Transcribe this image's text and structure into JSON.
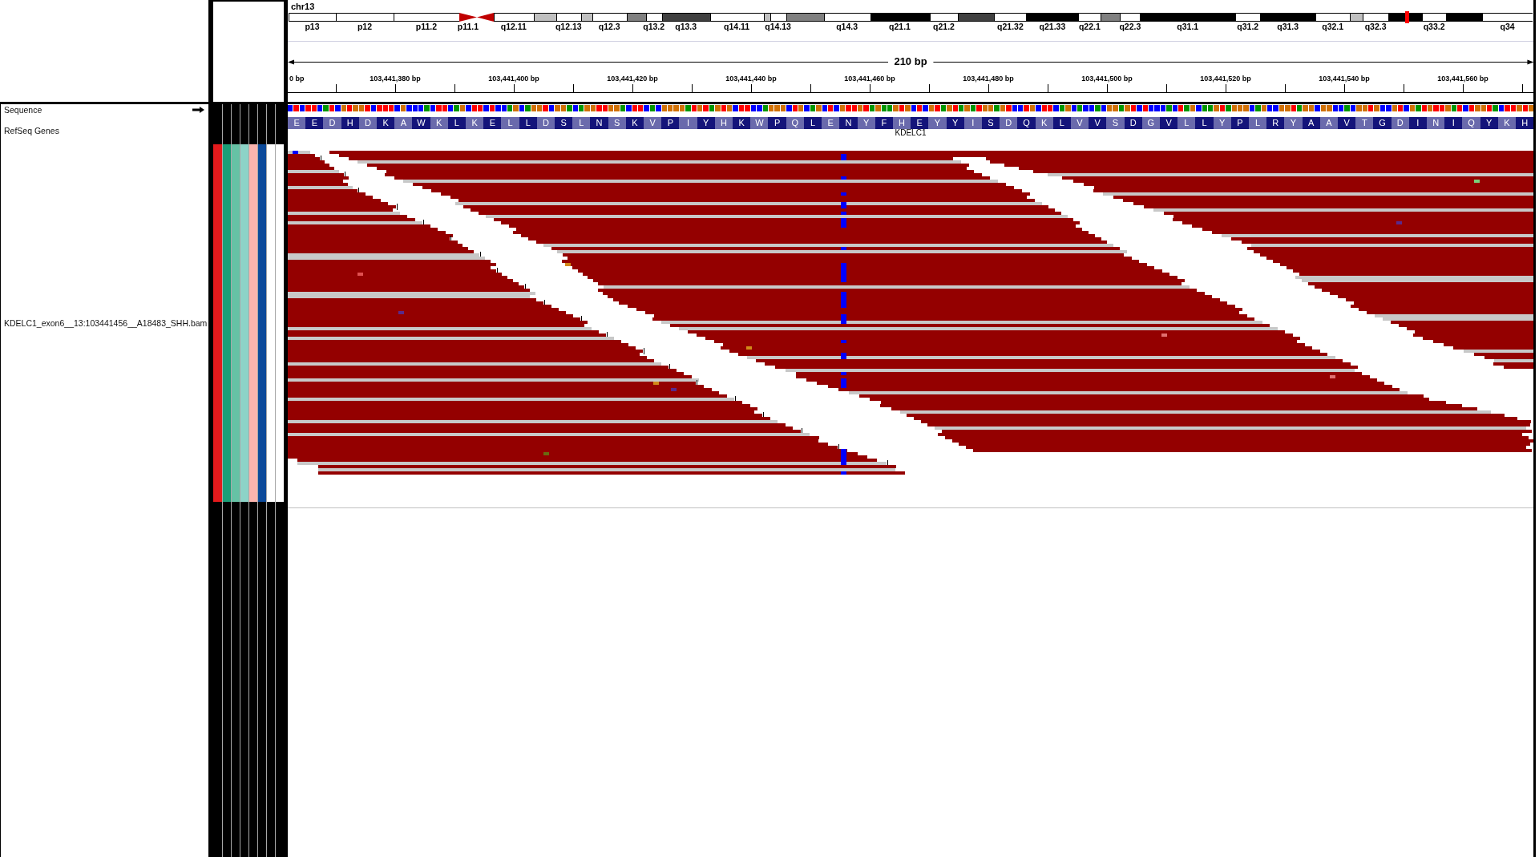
{
  "ideogram": {
    "chromosome": "chr13",
    "bands": [
      {
        "kind": "band",
        "color": "#ffffff",
        "label": "p13"
      },
      {
        "kind": "band",
        "color": "#ffffff",
        "label": "p12"
      },
      {
        "kind": "band",
        "color": "#ffffff",
        "label": "p11.2"
      },
      {
        "kind": "centromere",
        "color": "#c00000",
        "label": "p11.1"
      },
      {
        "kind": "centromere",
        "color": "#c00000"
      },
      {
        "kind": "band",
        "color": "#ffffff",
        "label": "q12.11"
      },
      {
        "kind": "band",
        "color": "#c0c0c0"
      },
      {
        "kind": "band",
        "color": "#ffffff",
        "label": "q12.13"
      },
      {
        "kind": "band",
        "color": "#c0c0c0"
      },
      {
        "kind": "band",
        "color": "#ffffff",
        "label": "q12.3"
      },
      {
        "kind": "band",
        "color": "#808080"
      },
      {
        "kind": "band",
        "color": "#ffffff",
        "label": "q13.2"
      },
      {
        "kind": "band",
        "color": "#404040",
        "label": "q13.3"
      },
      {
        "kind": "band",
        "color": "#ffffff",
        "label": "q14.11"
      },
      {
        "kind": "band",
        "color": "#c0c0c0"
      },
      {
        "kind": "band",
        "color": "#ffffff",
        "label": "q14.13"
      },
      {
        "kind": "band",
        "color": "#808080"
      },
      {
        "kind": "band",
        "color": "#ffffff",
        "label": "q14.3"
      },
      {
        "kind": "band",
        "color": "#000000",
        "label": "q21.1"
      },
      {
        "kind": "band",
        "color": "#ffffff",
        "label": "q21.2"
      },
      {
        "kind": "band",
        "color": "#404040"
      },
      {
        "kind": "band",
        "color": "#ffffff",
        "label": "q21.32"
      },
      {
        "kind": "band",
        "color": "#000000",
        "label": "q21.33"
      },
      {
        "kind": "band",
        "color": "#ffffff",
        "label": "q22.1"
      },
      {
        "kind": "band",
        "color": "#808080"
      },
      {
        "kind": "band",
        "color": "#ffffff",
        "label": "q22.3"
      },
      {
        "kind": "band",
        "color": "#000000",
        "label": "q31.1"
      },
      {
        "kind": "band",
        "color": "#ffffff",
        "label": "q31.2"
      },
      {
        "kind": "band",
        "color": "#000000",
        "label": "q31.3"
      },
      {
        "kind": "band",
        "color": "#ffffff",
        "label": "q32.1"
      },
      {
        "kind": "band",
        "color": "#c0c0c0"
      },
      {
        "kind": "band",
        "color": "#ffffff",
        "label": "q32.3"
      },
      {
        "kind": "band",
        "color": "#000000"
      },
      {
        "kind": "band",
        "color": "#ffffff",
        "label": "q33.2"
      },
      {
        "kind": "band",
        "color": "#000000"
      },
      {
        "kind": "band",
        "color": "#ffffff",
        "label": "q34"
      }
    ]
  },
  "ruler": {
    "span": "210 bp",
    "tick_labels": [
      "0 bp",
      "103,441,380 bp",
      "103,441,400 bp",
      "103,441,420 bp",
      "103,441,440 bp",
      "103,441,460 bp",
      "103,441,480 bp",
      "103,441,500 bp",
      "103,441,520 bp",
      "103,441,540 bp",
      "103,441,560 bp"
    ]
  },
  "tracks": [
    {
      "kind": "sequence",
      "name": "Sequence",
      "forward_strand": true,
      "bases": [
        {
          "color": "#0000ff"
        },
        {
          "color": "#ff0000"
        },
        {
          "color": "#0000ff"
        },
        {
          "color": "#ff0000"
        },
        {
          "color": "#ff0000"
        },
        {
          "color": "#0000ff"
        },
        {
          "color": "#009600"
        },
        {
          "color": "#ff0000"
        },
        {
          "color": "#0000ff"
        },
        {
          "color": "#d17105"
        },
        {
          "color": "#ff0000"
        },
        {
          "color": "#d17105"
        },
        {
          "color": "#d17105"
        },
        {
          "color": "#ff0000"
        },
        {
          "color": "#0000ff"
        },
        {
          "color": "#ff0000"
        },
        {
          "color": "#ff0000"
        },
        {
          "color": "#ff0000"
        },
        {
          "color": "#0000ff"
        },
        {
          "color": "#d17105"
        },
        {
          "color": "#0000ff"
        },
        {
          "color": "#0000ff"
        },
        {
          "color": "#0000ff"
        },
        {
          "color": "#009600"
        },
        {
          "color": "#0000ff"
        },
        {
          "color": "#ff0000"
        },
        {
          "color": "#ff0000"
        },
        {
          "color": "#0000ff"
        },
        {
          "color": "#009600"
        },
        {
          "color": "#d17105"
        },
        {
          "color": "#0000ff"
        },
        {
          "color": "#ff0000"
        },
        {
          "color": "#ff0000"
        },
        {
          "color": "#0000ff"
        },
        {
          "color": "#ff0000"
        },
        {
          "color": "#0000ff"
        },
        {
          "color": "#0000ff"
        },
        {
          "color": "#009600"
        },
        {
          "color": "#d17105"
        },
        {
          "color": "#0000ff"
        },
        {
          "color": "#009600"
        },
        {
          "color": "#d17105"
        },
        {
          "color": "#d17105"
        },
        {
          "color": "#ff0000"
        },
        {
          "color": "#0000ff"
        },
        {
          "color": "#d17105"
        },
        {
          "color": "#d17105"
        },
        {
          "color": "#009600"
        },
        {
          "color": "#0000ff"
        },
        {
          "color": "#009600"
        },
        {
          "color": "#d17105"
        },
        {
          "color": "#d17105"
        },
        {
          "color": "#ff0000"
        },
        {
          "color": "#ff0000"
        },
        {
          "color": "#d17105"
        },
        {
          "color": "#d17105"
        },
        {
          "color": "#009600"
        },
        {
          "color": "#0000ff"
        },
        {
          "color": "#ff0000"
        },
        {
          "color": "#ff0000"
        },
        {
          "color": "#0000ff"
        },
        {
          "color": "#009600"
        },
        {
          "color": "#0000ff"
        },
        {
          "color": "#d17105"
        },
        {
          "color": "#d17105"
        },
        {
          "color": "#d17105"
        },
        {
          "color": "#d17105"
        },
        {
          "color": "#009600"
        },
        {
          "color": "#ff0000"
        },
        {
          "color": "#d17105"
        },
        {
          "color": "#ff0000"
        },
        {
          "color": "#009600"
        },
        {
          "color": "#d17105"
        },
        {
          "color": "#ff0000"
        },
        {
          "color": "#d17105"
        },
        {
          "color": "#0000ff"
        },
        {
          "color": "#ff0000"
        },
        {
          "color": "#ff0000"
        },
        {
          "color": "#0000ff"
        },
        {
          "color": "#0000ff"
        },
        {
          "color": "#009600"
        },
        {
          "color": "#d17105"
        },
        {
          "color": "#d17105"
        },
        {
          "color": "#d17105"
        },
        {
          "color": "#0000ff"
        },
        {
          "color": "#ff0000"
        },
        {
          "color": "#d17105"
        },
        {
          "color": "#0000ff"
        },
        {
          "color": "#009600"
        },
        {
          "color": "#d17105"
        },
        {
          "color": "#0000ff"
        },
        {
          "color": "#ff0000"
        },
        {
          "color": "#0000ff"
        },
        {
          "color": "#d17105"
        },
        {
          "color": "#ff0000"
        },
        {
          "color": "#ff0000"
        },
        {
          "color": "#d17105"
        },
        {
          "color": "#ff0000"
        },
        {
          "color": "#009600"
        },
        {
          "color": "#d17105"
        },
        {
          "color": "#009600"
        },
        {
          "color": "#009600"
        },
        {
          "color": "#d17105"
        },
        {
          "color": "#ff0000"
        },
        {
          "color": "#d17105"
        },
        {
          "color": "#0000ff"
        },
        {
          "color": "#ff0000"
        },
        {
          "color": "#0000ff"
        },
        {
          "color": "#d17105"
        },
        {
          "color": "#ff0000"
        },
        {
          "color": "#009600"
        },
        {
          "color": "#d17105"
        },
        {
          "color": "#ff0000"
        },
        {
          "color": "#009600"
        },
        {
          "color": "#d17105"
        },
        {
          "color": "#009600"
        },
        {
          "color": "#ff0000"
        },
        {
          "color": "#d17105"
        },
        {
          "color": "#d17105"
        },
        {
          "color": "#009600"
        },
        {
          "color": "#d17105"
        },
        {
          "color": "#ff0000"
        },
        {
          "color": "#0000ff"
        },
        {
          "color": "#0000ff"
        },
        {
          "color": "#ff0000"
        },
        {
          "color": "#d17105"
        },
        {
          "color": "#0000ff"
        },
        {
          "color": "#ff0000"
        },
        {
          "color": "#ff0000"
        },
        {
          "color": "#0000ff"
        },
        {
          "color": "#009600"
        },
        {
          "color": "#d17105"
        },
        {
          "color": "#0000ff"
        },
        {
          "color": "#009600"
        },
        {
          "color": "#0000ff"
        },
        {
          "color": "#0000ff"
        },
        {
          "color": "#009600"
        },
        {
          "color": "#0000ff"
        },
        {
          "color": "#d17105"
        },
        {
          "color": "#d17105"
        },
        {
          "color": "#009600"
        },
        {
          "color": "#d17105"
        },
        {
          "color": "#ff0000"
        },
        {
          "color": "#0000ff"
        },
        {
          "color": "#ff0000"
        },
        {
          "color": "#0000ff"
        },
        {
          "color": "#0000ff"
        },
        {
          "color": "#0000ff"
        },
        {
          "color": "#009600"
        },
        {
          "color": "#0000ff"
        },
        {
          "color": "#ff0000"
        },
        {
          "color": "#009600"
        },
        {
          "color": "#d17105"
        },
        {
          "color": "#0000ff"
        },
        {
          "color": "#009600"
        },
        {
          "color": "#009600"
        },
        {
          "color": "#d17105"
        },
        {
          "color": "#ff0000"
        },
        {
          "color": "#009600"
        },
        {
          "color": "#d17105"
        },
        {
          "color": "#d17105"
        },
        {
          "color": "#d17105"
        },
        {
          "color": "#0000ff"
        },
        {
          "color": "#009600"
        },
        {
          "color": "#d17105"
        },
        {
          "color": "#0000ff"
        },
        {
          "color": "#0000ff"
        },
        {
          "color": "#d17105"
        },
        {
          "color": "#d17105"
        },
        {
          "color": "#ff0000"
        },
        {
          "color": "#009600"
        },
        {
          "color": "#d17105"
        },
        {
          "color": "#d17105"
        },
        {
          "color": "#0000ff"
        },
        {
          "color": "#d17105"
        },
        {
          "color": "#d17105"
        },
        {
          "color": "#0000ff"
        },
        {
          "color": "#0000ff"
        },
        {
          "color": "#009600"
        },
        {
          "color": "#0000ff"
        },
        {
          "color": "#d17105"
        },
        {
          "color": "#d17105"
        },
        {
          "color": "#ff0000"
        },
        {
          "color": "#d17105"
        },
        {
          "color": "#0000ff"
        },
        {
          "color": "#0000ff"
        },
        {
          "color": "#d17105"
        },
        {
          "color": "#ff0000"
        },
        {
          "color": "#0000ff"
        },
        {
          "color": "#d17105"
        },
        {
          "color": "#009600"
        },
        {
          "color": "#ff0000"
        },
        {
          "color": "#d17105"
        },
        {
          "color": "#ff0000"
        },
        {
          "color": "#ff0000"
        },
        {
          "color": "#d17105"
        },
        {
          "color": "#009600"
        },
        {
          "color": "#ff0000"
        },
        {
          "color": "#0000ff"
        },
        {
          "color": "#ff0000"
        },
        {
          "color": "#d17105"
        },
        {
          "color": "#d17105"
        },
        {
          "color": "#ff0000"
        },
        {
          "color": "#009600"
        },
        {
          "color": "#0000ff"
        },
        {
          "color": "#ff0000"
        },
        {
          "color": "#ff0000"
        },
        {
          "color": "#d17105"
        },
        {
          "color": "#ff0000"
        },
        {
          "color": "#d17105"
        }
      ]
    },
    {
      "kind": "gene",
      "name": "RefSeq Genes",
      "amino_acids": [
        "E",
        "E",
        "D",
        "H",
        "D",
        "K",
        "A",
        "W",
        "K",
        "L",
        "K",
        "E",
        "L",
        "L",
        "D",
        "S",
        "L",
        "N",
        "S",
        "K",
        "V",
        "P",
        "I",
        "Y",
        "H",
        "K",
        "W",
        "P",
        "Q",
        "L",
        "E",
        "N",
        "Y",
        "F",
        "H",
        "E",
        "Y",
        "Y",
        "I",
        "S",
        "D",
        "Q",
        "K",
        "L",
        "V",
        "V",
        "S",
        "D",
        "G",
        "V",
        "L",
        "L",
        "Y",
        "P",
        "L",
        "R",
        "Y",
        "A",
        "A",
        "V",
        "T",
        "G",
        "D",
        "I",
        "N",
        "I",
        "Q",
        "Y",
        "K",
        "H"
      ],
      "gene": "KDELC1"
    },
    {
      "kind": "alignment",
      "name": "KDELC1_exon6__13:103441456__A18483_SHH.bam",
      "attributes": [
        {
          "color": "#e41a1c"
        },
        {
          "color": "#1b9e77"
        },
        {
          "color": "#66c2a5"
        },
        {
          "color": "#8dd3c7"
        },
        {
          "color": "#fbb4ae"
        },
        {
          "color": "#0c4a9a"
        },
        {
          "color": "#ffffff"
        },
        {
          "color": "#ffffff"
        }
      ]
    }
  ]
}
